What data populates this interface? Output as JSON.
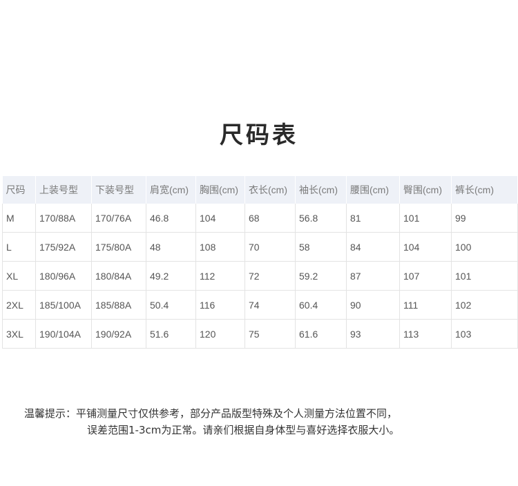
{
  "title": "尺码表",
  "table": {
    "headers": [
      "尺码",
      "上装号型",
      "下装号型",
      "肩宽(cm)",
      "胸围(cm)",
      "衣长(cm)",
      "袖长(cm)",
      "腰围(cm)",
      "臀围(cm)",
      "裤长(cm)"
    ],
    "rows": [
      [
        "M",
        "170/88A",
        "170/76A",
        "46.8",
        "104",
        "68",
        "56.8",
        "81",
        "101",
        "99"
      ],
      [
        "L",
        "175/92A",
        "175/80A",
        "48",
        "108",
        "70",
        "58",
        "84",
        "104",
        "100"
      ],
      [
        "XL",
        "180/96A",
        "180/84A",
        "49.2",
        "112",
        "72",
        "59.2",
        "87",
        "107",
        "101"
      ],
      [
        "2XL",
        "185/100A",
        "185/88A",
        "50.4",
        "116",
        "74",
        "60.4",
        "90",
        "111",
        "102"
      ],
      [
        "3XL",
        "190/104A",
        "190/92A",
        "51.6",
        "120",
        "75",
        "61.6",
        "93",
        "113",
        "103"
      ]
    ]
  },
  "note": {
    "line1": "温馨提示：平铺测量尺寸仅供参考，部分产品版型特殊及个人测量方法位置不同，",
    "line2": "误差范围1-3cm为正常。请亲们根据自身体型与喜好选择衣服大小。"
  }
}
